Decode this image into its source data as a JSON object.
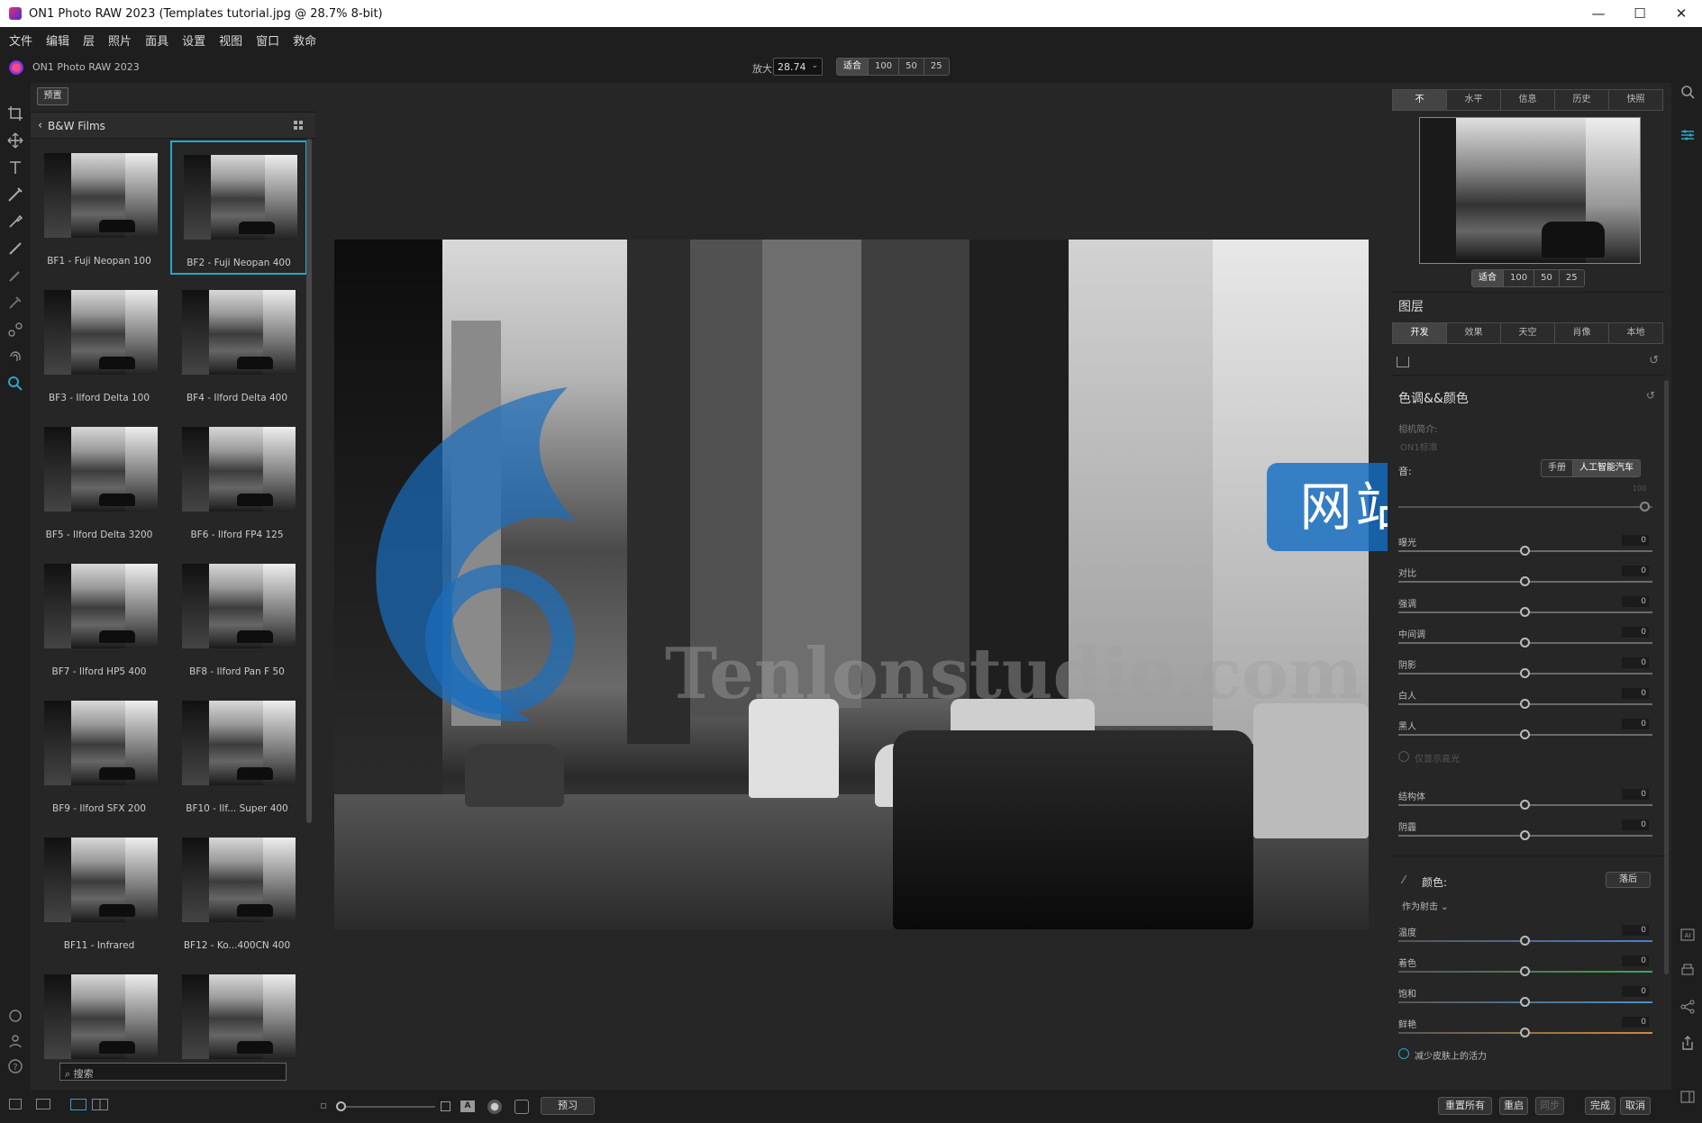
{
  "window": {
    "title": "ON1 Photo RAW 2023 (Templates tutorial.jpg @ 28.7% 8-bit)",
    "minimize": "—",
    "maximize": "☐",
    "close": "✕"
  },
  "menu": [
    "文件",
    "编辑",
    "层",
    "照片",
    "面具",
    "设置",
    "视图",
    "窗口",
    "救命"
  ],
  "toolbar": {
    "app_name": "ON1 Photo RAW 2023",
    "zoom_label": "放大",
    "zoom_value": "28.74",
    "zoom_buttons": [
      "适合",
      "100",
      "50",
      "25"
    ]
  },
  "browser": {
    "tab_label": "预置",
    "category": "B&W Films",
    "presets": [
      {
        "label": "BF1 - Fuji Neopan 100",
        "selected": false
      },
      {
        "label": "BF2 - Fuji Neopan 400",
        "selected": true
      },
      {
        "label": "BF3 - Ilford Delta 100",
        "selected": false
      },
      {
        "label": "BF4 - Ilford Delta 400",
        "selected": false
      },
      {
        "label": "BF5 - Ilford Delta 3200",
        "selected": false
      },
      {
        "label": "BF6 - Ilford FP4 125",
        "selected": false
      },
      {
        "label": "BF7 - Ilford HP5 400",
        "selected": false
      },
      {
        "label": "BF8 - Ilford Pan F 50",
        "selected": false
      },
      {
        "label": "BF9 - Ilford SFX 200",
        "selected": false
      },
      {
        "label": "BF10 - Ilf... Super 400",
        "selected": false
      },
      {
        "label": "BF11 - Infrared",
        "selected": false
      },
      {
        "label": "BF12 - Ko...400CN 400",
        "selected": false
      },
      {
        "label": "",
        "selected": false
      },
      {
        "label": "",
        "selected": false
      }
    ],
    "search_placeholder": "搜索"
  },
  "bottombar": {
    "preview_label": "预习",
    "reset_all": "重置所有",
    "reset": "重启",
    "sync": "同步",
    "done": "完成",
    "cancel": "取消"
  },
  "watermark": {
    "text": "网站",
    "url": "Tenlonstudio.com"
  },
  "right_panel": {
    "top_tabs": [
      "不",
      "水平",
      "信息",
      "历史",
      "快照"
    ],
    "nav_zoom_buttons": [
      "适合",
      "100",
      "50",
      "25"
    ],
    "layers_title": "图层",
    "dev_tabs": [
      "开发",
      "效果",
      "天空",
      "肖像",
      "本地"
    ],
    "tone_title": "色调&&颜色",
    "camera_profile_label": "相机简介:",
    "camera_profile_value": "ON1标准",
    "tone_label": "音:",
    "mode_buttons": [
      "手册",
      "人工智能汽车"
    ],
    "ai_slider_value": "100",
    "tone_sliders": [
      {
        "name": "曝光",
        "value": "0"
      },
      {
        "name": "对比",
        "value": "0"
      },
      {
        "name": "强调",
        "value": "0"
      },
      {
        "name": "中间调",
        "value": "0"
      },
      {
        "name": "阴影",
        "value": "0"
      },
      {
        "name": "白人",
        "value": "0"
      },
      {
        "name": "黑人",
        "value": "0"
      }
    ],
    "protect_label": "仅显示高光",
    "structure_sliders": [
      {
        "name": "结构体",
        "value": "0"
      },
      {
        "name": "阴霾",
        "value": "0"
      }
    ],
    "color_title": "颜色:",
    "color_btn": "落后",
    "as_shot": "作为射击",
    "color_sliders": [
      {
        "name": "温度",
        "value": "0",
        "color": "#4a7fd0"
      },
      {
        "name": "着色",
        "value": "0",
        "color": "#3aa856"
      },
      {
        "name": "饱和",
        "value": "0",
        "color": "#4a90c8"
      },
      {
        "name": "鲜艳",
        "value": "0",
        "color": "#d08a3a"
      }
    ],
    "skin_label": "减少皮肤上的活力"
  },
  "colors": {
    "accent": "#29a5c9",
    "watermark_blue": "#156ec3"
  }
}
